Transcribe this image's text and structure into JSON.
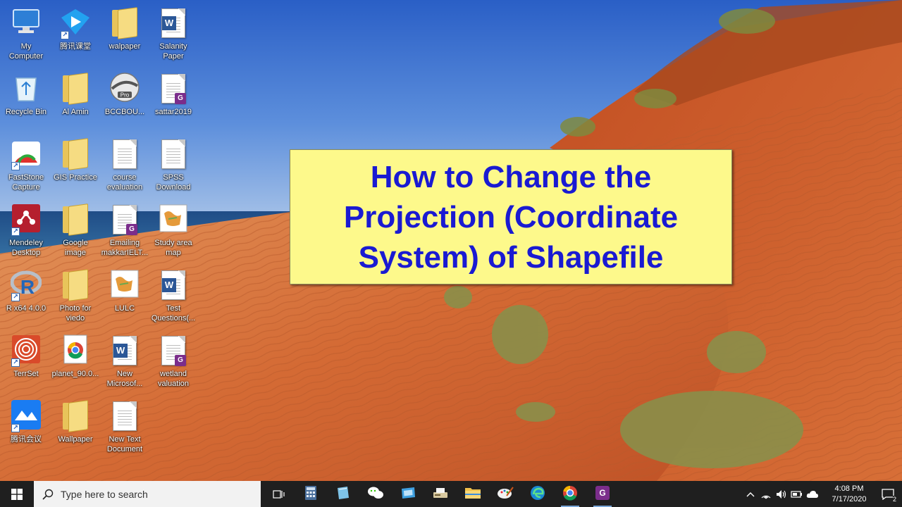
{
  "desktop": {
    "icons": [
      {
        "id": "my-computer",
        "label": "My\nComputer",
        "icon": "computer-icon"
      },
      {
        "id": "tencent-classroom",
        "label": "腾讯课堂",
        "icon": "tencent-classroom-icon",
        "shortcut": true
      },
      {
        "id": "walpaper",
        "label": "walpaper",
        "icon": "folder-icon"
      },
      {
        "id": "salanity-paper",
        "label": "Salanity\nPaper",
        "icon": "word-document-icon"
      },
      {
        "id": "recycle-bin",
        "label": "Recycle Bin",
        "icon": "recycle-bin-icon"
      },
      {
        "id": "al-amin",
        "label": "Al Amin",
        "icon": "folder-icon"
      },
      {
        "id": "bccbou",
        "label": "BCCBOU...",
        "icon": "google-earth-pro-icon"
      },
      {
        "id": "sattar2019",
        "label": "sattar2019",
        "icon": "gpdf-document-icon"
      },
      {
        "id": "faststone-capture",
        "label": "FastStone\nCapture",
        "icon": "faststone-capture-icon",
        "shortcut": true
      },
      {
        "id": "gis-practice",
        "label": "GIS Practice",
        "icon": "folder-icon"
      },
      {
        "id": "course-evaluation",
        "label": "course\nevaluation",
        "icon": "text-document-icon"
      },
      {
        "id": "spss-download",
        "label": "SPSS\nDownload",
        "icon": "text-document-icon"
      },
      {
        "id": "mendeley-desktop",
        "label": "Mendeley\nDesktop",
        "icon": "mendeley-icon",
        "shortcut": true
      },
      {
        "id": "google-image",
        "label": "Google\nimage",
        "icon": "folder-icon"
      },
      {
        "id": "emailing-makkar",
        "label": "Emailing\nmakkarIELT...",
        "icon": "gpdf-document-icon"
      },
      {
        "id": "study-area-map",
        "label": "Study area\nmap",
        "icon": "map-image-icon"
      },
      {
        "id": "r-x64",
        "label": "R x64 4.0.0",
        "icon": "r-language-icon",
        "shortcut": true
      },
      {
        "id": "photo-for-viedo",
        "label": "Photo for\nviedo",
        "icon": "folder-icon"
      },
      {
        "id": "lulc",
        "label": "LULC",
        "icon": "map-image-icon"
      },
      {
        "id": "test-questions",
        "label": "Test\nQuestions(...",
        "icon": "word-document-icon"
      },
      {
        "id": "terrset",
        "label": "TerrSet",
        "icon": "terrset-icon",
        "shortcut": true
      },
      {
        "id": "planet-90",
        "label": "planet_90.0...",
        "icon": "chrome-document-icon"
      },
      {
        "id": "new-microsoft",
        "label": "New\nMicrosof...",
        "icon": "word-document-icon"
      },
      {
        "id": "wetland-valuation",
        "label": "wetland\nvaluation",
        "icon": "gpdf-document-icon"
      },
      {
        "id": "tencent-meeting",
        "label": "腾讯会议",
        "icon": "tencent-meeting-icon",
        "shortcut": true
      },
      {
        "id": "wallpaper",
        "label": "Wallpaper",
        "icon": "folder-icon"
      },
      {
        "id": "new-text-document",
        "label": "New Text\nDocument",
        "icon": "text-document-icon"
      }
    ]
  },
  "title_card": {
    "text": "How to Change the\nProjection (Coordinate\nSystem) of Shapefile",
    "background": "#fdf98b",
    "text_color": "#1a1ad2"
  },
  "taskbar": {
    "search_placeholder": "Type here to search",
    "apps": [
      {
        "id": "calculator",
        "icon": "calculator-icon"
      },
      {
        "id": "notes",
        "icon": "notes-icon"
      },
      {
        "id": "wechat",
        "icon": "wechat-icon"
      },
      {
        "id": "screen-capture",
        "icon": "screen-capture-icon"
      },
      {
        "id": "scanner",
        "icon": "scanner-icon"
      },
      {
        "id": "file-explorer",
        "icon": "file-explorer-icon"
      },
      {
        "id": "paint",
        "icon": "paint-icon"
      },
      {
        "id": "edge",
        "icon": "edge-icon"
      },
      {
        "id": "chrome",
        "icon": "chrome-icon",
        "running": true
      },
      {
        "id": "gpdf",
        "icon": "gpdf-icon",
        "running": true
      }
    ],
    "clock_time": "4:08 PM",
    "clock_date": "7/17/2020",
    "notification_count": "2"
  }
}
